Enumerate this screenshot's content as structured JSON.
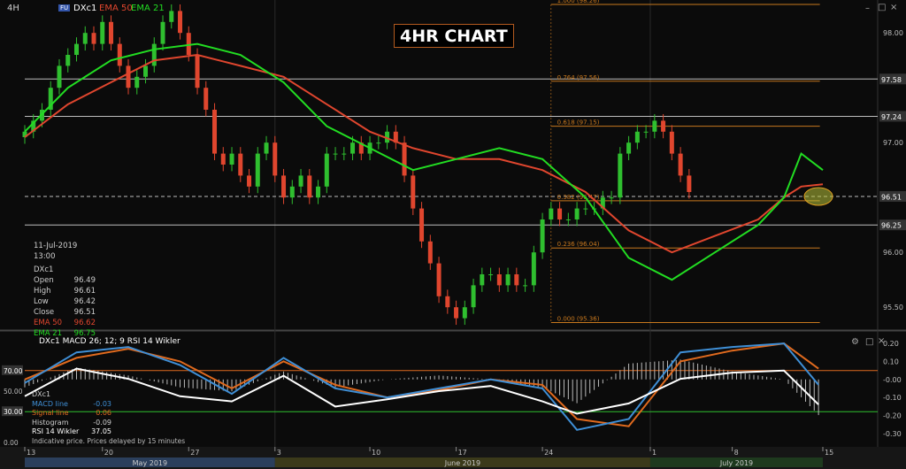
{
  "header": {
    "timeframe": "4H",
    "symbol_badge": "FU",
    "symbol": "DXc1",
    "ema50_label": "EMA 50",
    "ema21_label": "EMA 21"
  },
  "badge_text": "4HR CHART",
  "info_box": {
    "date": "11-Jul-2019 13:00",
    "symbol": "DXc1",
    "rows": [
      {
        "label": "Open",
        "value": "96.49"
      },
      {
        "label": "High",
        "value": "96.61"
      },
      {
        "label": "Low",
        "value": "96.42"
      },
      {
        "label": "Close",
        "value": "96.51"
      },
      {
        "label": "EMA 50",
        "value": "96.62"
      },
      {
        "label": "EMA 21",
        "value": "96.75"
      }
    ]
  },
  "lower_header": "DXc1  MACD 26; 12; 9  RSI 14 Wikler",
  "lower_legend": {
    "symbol": "DXc1",
    "rows": [
      {
        "label": "MACD line",
        "value": "-0.03"
      },
      {
        "label": "Signal line",
        "value": "0.06"
      },
      {
        "label": "Histogram",
        "value": "-0.09"
      },
      {
        "label": "RSI 14 Wikler",
        "value": "37.05"
      }
    ],
    "note": "Indicative price. Prices delayed by 15 minutes"
  },
  "colors": {
    "ema50": "#e0462e",
    "ema21": "#22dd22",
    "fib": "#c8781e",
    "macd": "#3f8fd6",
    "signal": "#e06a1e",
    "rsi": "#ffffff",
    "up": "#2fbf2f",
    "down": "#e0462e",
    "bg": "#0b0b0b",
    "highlight": "#b8c23a"
  },
  "chart_data": [
    {
      "type": "candlestick",
      "title": "4HR CHART",
      "ylim": [
        95.3,
        98.3
      ],
      "right_ticks": [
        "98.00",
        "97.00",
        "96.00",
        "95.50"
      ],
      "horizontal_levels": [
        {
          "label": "97.58",
          "value": 97.58
        },
        {
          "label": "97.24",
          "value": 97.24
        },
        {
          "label": "96.51",
          "value": 96.51,
          "style": "dashed"
        },
        {
          "label": "96.25",
          "value": 96.25
        }
      ],
      "fib_levels": [
        {
          "label": "1.000 (98.26)",
          "value": 98.26
        },
        {
          "label": "0.764 (97.56)",
          "value": 97.56
        },
        {
          "label": "0.618 (97.15)",
          "value": 97.15
        },
        {
          "label": "0.382 (96.47)",
          "value": 96.47
        },
        {
          "label": "0.236 (96.04)",
          "value": 96.04
        },
        {
          "label": "0.000 (95.36)",
          "value": 95.36
        }
      ],
      "series": [
        {
          "name": "DXc1",
          "type": "candles",
          "x": [
            0,
            10,
            20,
            30,
            40,
            50,
            60,
            70,
            80,
            90,
            100,
            110,
            120,
            130,
            140,
            150,
            160,
            170,
            180,
            190,
            200,
            210,
            220,
            230,
            240,
            250,
            260,
            270,
            280,
            290,
            300,
            310,
            320,
            330,
            340,
            350,
            360,
            370,
            380,
            390,
            400,
            410,
            420,
            430,
            440,
            450,
            460,
            470,
            480,
            490,
            500,
            510,
            520,
            530,
            540,
            550,
            560,
            570,
            580,
            590,
            600,
            610,
            620,
            630,
            640,
            650,
            660,
            670,
            680,
            690,
            700,
            710,
            720,
            730,
            740,
            750,
            760,
            770,
            780,
            790,
            800,
            810,
            820,
            830,
            840,
            850,
            860,
            870,
            880,
            890,
            900,
            910,
            920,
            925
          ],
          "close": [
            97.1,
            97.2,
            97.3,
            97.5,
            97.7,
            97.8,
            97.9,
            98.0,
            97.9,
            98.1,
            97.9,
            97.7,
            97.5,
            97.6,
            97.7,
            97.9,
            98.1,
            98.2,
            98.0,
            97.8,
            97.5,
            97.3,
            96.9,
            96.8,
            96.9,
            96.7,
            96.6,
            96.9,
            97.0,
            96.7,
            96.5,
            96.6,
            96.7,
            96.5,
            96.6,
            96.9,
            96.9,
            96.9,
            97.0,
            96.9,
            97.0,
            97.0,
            97.1,
            97.0,
            96.7,
            96.4,
            96.1,
            95.9,
            95.6,
            95.5,
            95.4,
            95.5,
            95.7,
            95.8,
            95.8,
            95.7,
            95.8,
            95.7,
            95.7,
            96.0,
            96.3,
            96.4,
            96.3,
            96.3,
            96.4,
            96.4,
            96.4,
            96.5,
            96.5,
            96.9,
            97.0,
            97.1,
            97.1,
            97.2,
            97.1,
            96.9,
            96.7,
            96.55
          ]
        },
        {
          "name": "EMA 50",
          "type": "line",
          "x": [
            0,
            50,
            100,
            150,
            200,
            250,
            300,
            350,
            400,
            450,
            500,
            550,
            600,
            650,
            700,
            750,
            800,
            850,
            880,
            900,
            925
          ],
          "y": [
            97.05,
            97.35,
            97.55,
            97.75,
            97.8,
            97.7,
            97.6,
            97.35,
            97.1,
            96.95,
            96.85,
            96.85,
            96.75,
            96.55,
            96.2,
            96.0,
            96.15,
            96.3,
            96.5,
            96.6,
            96.62
          ]
        },
        {
          "name": "EMA 21",
          "type": "line",
          "x": [
            0,
            50,
            100,
            150,
            200,
            250,
            300,
            350,
            400,
            450,
            500,
            550,
            600,
            650,
            700,
            750,
            800,
            850,
            880,
            900,
            925
          ],
          "y": [
            97.1,
            97.5,
            97.75,
            97.85,
            97.9,
            97.8,
            97.55,
            97.15,
            96.95,
            96.75,
            96.85,
            96.95,
            96.85,
            96.5,
            95.95,
            95.75,
            96.0,
            96.25,
            96.5,
            96.9,
            96.75
          ]
        }
      ]
    },
    {
      "type": "line",
      "title": "DXc1  MACD 26; 12; 9  RSI 14 Wikler",
      "right_ticks": [
        "0.20",
        "0.10",
        "-0.00",
        "-0.10",
        "-0.20",
        "-0.30"
      ],
      "left_ticks": [
        "70.00",
        "50.00",
        "30.00",
        "0.00"
      ],
      "ylim": [
        -0.35,
        0.22
      ],
      "series": [
        {
          "name": "MACD line",
          "x": [
            0,
            60,
            120,
            180,
            240,
            300,
            360,
            420,
            480,
            540,
            600,
            640,
            700,
            760,
            820,
            880,
            920
          ],
          "y": [
            -0.02,
            0.15,
            0.18,
            0.08,
            -0.08,
            0.12,
            -0.05,
            -0.1,
            -0.05,
            0.0,
            -0.05,
            -0.28,
            -0.22,
            0.15,
            0.18,
            0.2,
            -0.03
          ]
        },
        {
          "name": "Signal line",
          "x": [
            0,
            60,
            120,
            180,
            240,
            300,
            360,
            420,
            480,
            540,
            600,
            640,
            700,
            760,
            820,
            880,
            920
          ],
          "y": [
            0.0,
            0.12,
            0.17,
            0.1,
            -0.05,
            0.1,
            -0.03,
            -0.1,
            -0.06,
            0.0,
            -0.03,
            -0.22,
            -0.26,
            0.1,
            0.16,
            0.2,
            0.06
          ]
        },
        {
          "name": "RSI 14 Wikler",
          "x": [
            0,
            60,
            120,
            180,
            240,
            300,
            360,
            420,
            480,
            540,
            600,
            640,
            700,
            760,
            820,
            880,
            920
          ],
          "y": [
            45,
            72,
            62,
            45,
            40,
            65,
            35,
            42,
            50,
            55,
            40,
            28,
            38,
            62,
            68,
            70,
            37
          ]
        }
      ]
    },
    {
      "type": "axis",
      "x_ticks": [
        "13",
        "20",
        "27",
        "3",
        "10",
        "17",
        "24",
        "1",
        "8",
        "15"
      ],
      "months": [
        "May 2019",
        "June 2019",
        "July 2019"
      ]
    }
  ]
}
